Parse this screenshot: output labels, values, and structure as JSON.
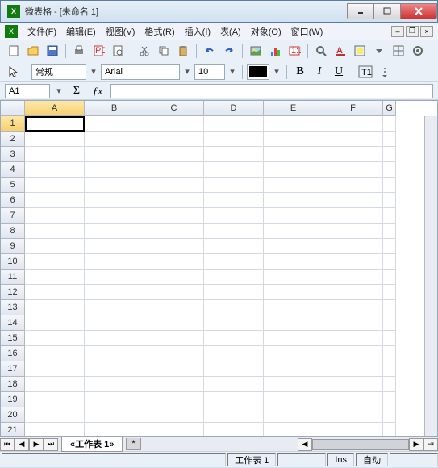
{
  "title": "微表格 - [未命名 1]",
  "menus": {
    "file": "文件(F)",
    "edit": "编辑(E)",
    "view": "视图(V)",
    "format": "格式(R)",
    "insert": "插入(I)",
    "table": "表(A)",
    "object": "对象(O)",
    "window": "窗口(W)"
  },
  "toolbar2": {
    "style": "常规",
    "font": "Arial",
    "size": "10",
    "swatch": "#000000"
  },
  "namebox": "A1",
  "columns": [
    "A",
    "B",
    "C",
    "D",
    "E",
    "F",
    "G"
  ],
  "rows": [
    "1",
    "2",
    "3",
    "4",
    "5",
    "6",
    "7",
    "8",
    "9",
    "10",
    "11",
    "12",
    "13",
    "14",
    "15",
    "16",
    "17",
    "18",
    "19",
    "20",
    "21"
  ],
  "active": {
    "col": 0,
    "row": 0
  },
  "sheet_tab": "«工作表 1»",
  "status": {
    "sheet": "工作表 1",
    "ins": "Ins",
    "auto": "自动"
  }
}
